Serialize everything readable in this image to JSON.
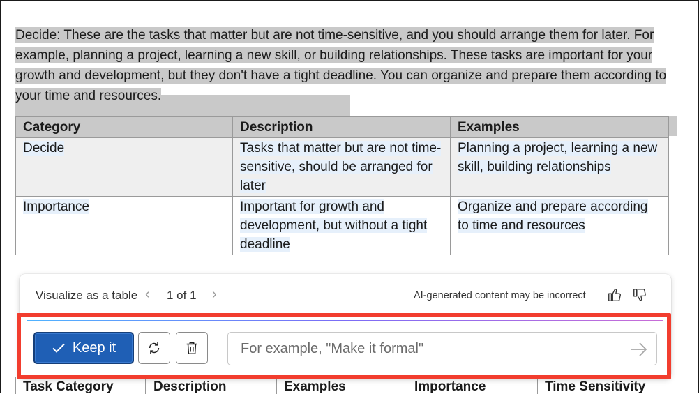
{
  "document": {
    "paragraph": "Decide: These are the tasks that matter but are not time-sensitive, and you should arrange them for later. For example, planning a project, learning a new skill, or building relationships. These tasks are important for your growth and development, but they don't have a tight deadline. You can organize and prepare them according to your time and resources.",
    "table": {
      "headers": [
        "Category",
        "Description",
        "Examples"
      ],
      "rows": [
        [
          "Decide",
          "Tasks that matter but are not time-sensitive, should be arranged for later",
          "Planning a project, learning a new skill, building relationships"
        ],
        [
          "Importance",
          "Important for growth and development, but without a tight deadline",
          "Organize and prepare according to time and resources"
        ]
      ]
    },
    "second_table_headers": [
      "Task Category",
      "Description",
      "Examples",
      "Importance",
      "Time Sensitivity"
    ]
  },
  "copilot_panel": {
    "action_label": "Visualize as a table",
    "pager": "1 of 1",
    "disclaimer": "AI-generated content may be incorrect",
    "keep_label": "Keep it",
    "prompt_placeholder": "For example, \"Make it formal\"",
    "accent_color": "#1f5fb5",
    "highlight_color": "#f23d2e"
  }
}
